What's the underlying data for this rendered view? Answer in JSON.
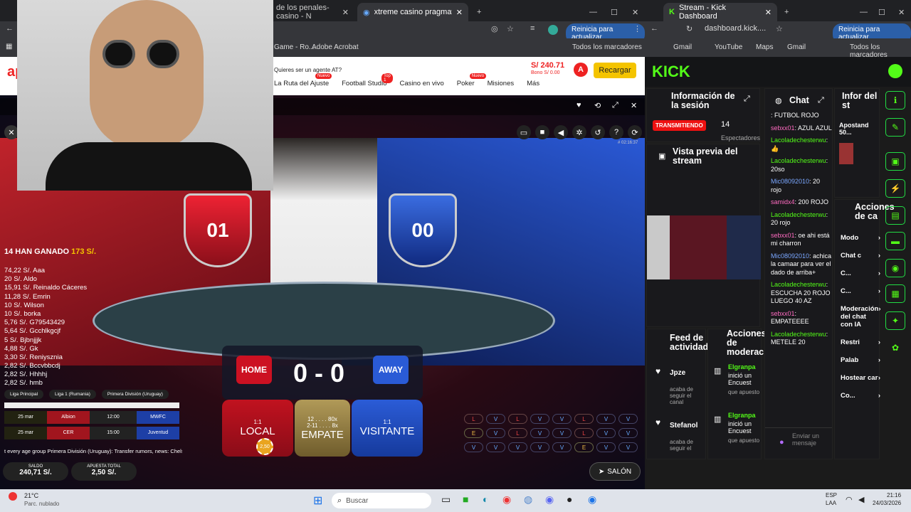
{
  "left_browser": {
    "tabs": [
      {
        "label": "de los penales-casino - N"
      },
      {
        "label": "xtreme casino pragmatic - Mas"
      }
    ],
    "update_label": "Reinicia para actualizar",
    "bookmarks": [
      "Game - Ro...",
      "Adobe Acrobat"
    ],
    "all_bookmarks": "Todos los marcadores"
  },
  "site": {
    "logo": "ap",
    "agent_text": "Quieres ser un agente AT?",
    "nav": [
      {
        "label": "La Ruta del Ajuste",
        "badge": "Nuevo"
      },
      {
        "label": "Football Studio",
        "badge": "Top 1"
      },
      {
        "label": "Casino en vivo",
        "badge": ""
      },
      {
        "label": "Poker",
        "badge": "Nuevo"
      },
      {
        "label": "Misiones",
        "badge": ""
      },
      {
        "label": "Más",
        "badge": ""
      }
    ],
    "balance": "S/ 240.71",
    "bono": "Bono S/ 0.00",
    "avatar_letter": "A",
    "recharge": "Recargar"
  },
  "game": {
    "home_score_shield": "01",
    "away_score_shield": "00",
    "timer": "# 02:16:37",
    "winners_header": "14 HAN GANADO",
    "winners_total": "173 S/.",
    "winners": [
      "74,22 S/. Aaa",
      "20 S/. Aldo",
      "15,91 S/. Reinaldo Cáceres",
      "11,28 S/. Emrin",
      "10 S/. Wilson",
      "10 S/. borka",
      "5,76 S/. G79543429",
      "5,64 S/. Gcchlkgcjf",
      "5 S/. Bjbnjjjk",
      "4,88 S/. Gk",
      "3,30 S/. Reniysznia",
      "2,82 S/. Bccvbbcdj",
      "2,82 S/. Hhhhj",
      "2,82 S/. hmb"
    ],
    "home_label": "HOME",
    "away_label": "AWAY",
    "score": "0 - 0",
    "leagues": [
      "Liga Principal",
      "Liga 1 (Rumania)",
      "Primera División (Uruguay)"
    ],
    "matches": [
      {
        "date": "25 mar",
        "home": "Albion",
        "time": "12:00",
        "away": "MWFC"
      },
      {
        "date": "25 mar",
        "home": "CER",
        "time": "15:00",
        "away": "Juventud"
      }
    ],
    "ticker": "t every age group   Primera División (Uruguay): Transfer rumors, news: Chels",
    "bets": [
      {
        "odds": "1:1",
        "name": "LOCAL",
        "extra": ""
      },
      {
        "odds": "12 . . . . 80x",
        "name": "EMPATE",
        "extra": "2-11 . . . . 8x"
      },
      {
        "odds": "1:1",
        "name": "VISITANTE",
        "extra": ""
      }
    ],
    "chip_value": "2,50",
    "board": [
      [
        "L",
        "V",
        "L",
        "V",
        "V",
        "L",
        "V",
        "V"
      ],
      [
        "E",
        "V",
        "L",
        "V",
        "V",
        "L",
        "V",
        "V"
      ],
      [
        "V",
        "V",
        "V",
        "V",
        "V",
        "E",
        "V",
        "V"
      ]
    ],
    "saldo_label": "SALDO",
    "saldo_value": "240,71 S/.",
    "apuesta_label": "APUESTA TOTAL",
    "apuesta_value": "2,50 S/.",
    "salon": "SALÓN"
  },
  "right_browser": {
    "tab": "Stream - Kick Dashboard",
    "url": "dashboard.kick....",
    "update_label": "Reinicia para actualizar",
    "bookmarks": [
      "Gmail",
      "YouTube",
      "Maps",
      "Gmail"
    ],
    "all_bookmarks": "Todos los marcadores"
  },
  "kick": {
    "logo": "KICK",
    "session_title": "Información de la sesión",
    "live_badge": "TRANSMITIENDO",
    "viewers": "14",
    "viewers_label": "Espectadores",
    "preview_title": "Vista previa del stream",
    "feed_title": "Feed de actividad",
    "mod_title": "Acciones de moderación",
    "chat_title": "Chat",
    "info_title": "Infor del st",
    "actions_title": "Acciones de ca",
    "feed": [
      {
        "user": "Jpze",
        "text": "acaba de seguir el canal"
      },
      {
        "user": "Stefanol",
        "text": "acaba de seguir el"
      }
    ],
    "mod": [
      {
        "user": "Elgranpa",
        "text": "inició un Encuest",
        "sub": "que apuesto"
      },
      {
        "user": "Elgranpa",
        "text": "inició un Encuest",
        "sub": "que apuesto"
      }
    ],
    "chat": [
      {
        "user": "",
        "text": ": FUTBOL ROJO",
        "c": ""
      },
      {
        "user": "sebxx01",
        "text": ": AZUL AZUL",
        "c": "u-p"
      },
      {
        "user": "Lacoladechesterwu",
        "text": ": 👍",
        "c": "u-g"
      },
      {
        "user": "Lacoladechesterwu",
        "text": ": 20so",
        "c": "u-g"
      },
      {
        "user": "Mic08092010",
        "text": ": 20 rojo",
        "c": "u-b"
      },
      {
        "user": "samidx4",
        "text": ": 200 ROJO",
        "c": "u-p"
      },
      {
        "user": "Lacoladechesterwu",
        "text": ": 20 rojo",
        "c": "u-g"
      },
      {
        "user": "sebxx01",
        "text": ": oe ahi está mi charron",
        "c": "u-p"
      },
      {
        "user": "Mic08092010",
        "text": ": achica la camaar para ver el dado de arriba+",
        "c": "u-b"
      },
      {
        "user": "Lacoladechesterwu",
        "text": ": ESCUCHA 20 ROJO LUEGO 40 AZ",
        "c": "u-g"
      },
      {
        "user": "sebxx01",
        "text": ": EMPATEEEE",
        "c": "u-p"
      },
      {
        "user": "Lacoladechesterwu",
        "text": ": METELE 20",
        "c": "u-g"
      }
    ],
    "chat_input": "Enviar un mensaje",
    "info_text": "Apostand 50...",
    "settings": [
      {
        "label": "Modo"
      },
      {
        "label": "Chat c"
      },
      {
        "label": "C..."
      },
      {
        "label": "C..."
      },
      {
        "label": "Moderación del chat con IA"
      },
      {
        "label": "Restri"
      },
      {
        "label": "Palab"
      },
      {
        "label": "Hostear car"
      },
      {
        "label": "Co..."
      }
    ]
  },
  "taskbar": {
    "temp": "21°C",
    "weather": "Parc. nublado",
    "search": "Buscar",
    "lang": "ESP",
    "lang2": "LAA",
    "time": "21:16",
    "date": "24/03/2026"
  }
}
